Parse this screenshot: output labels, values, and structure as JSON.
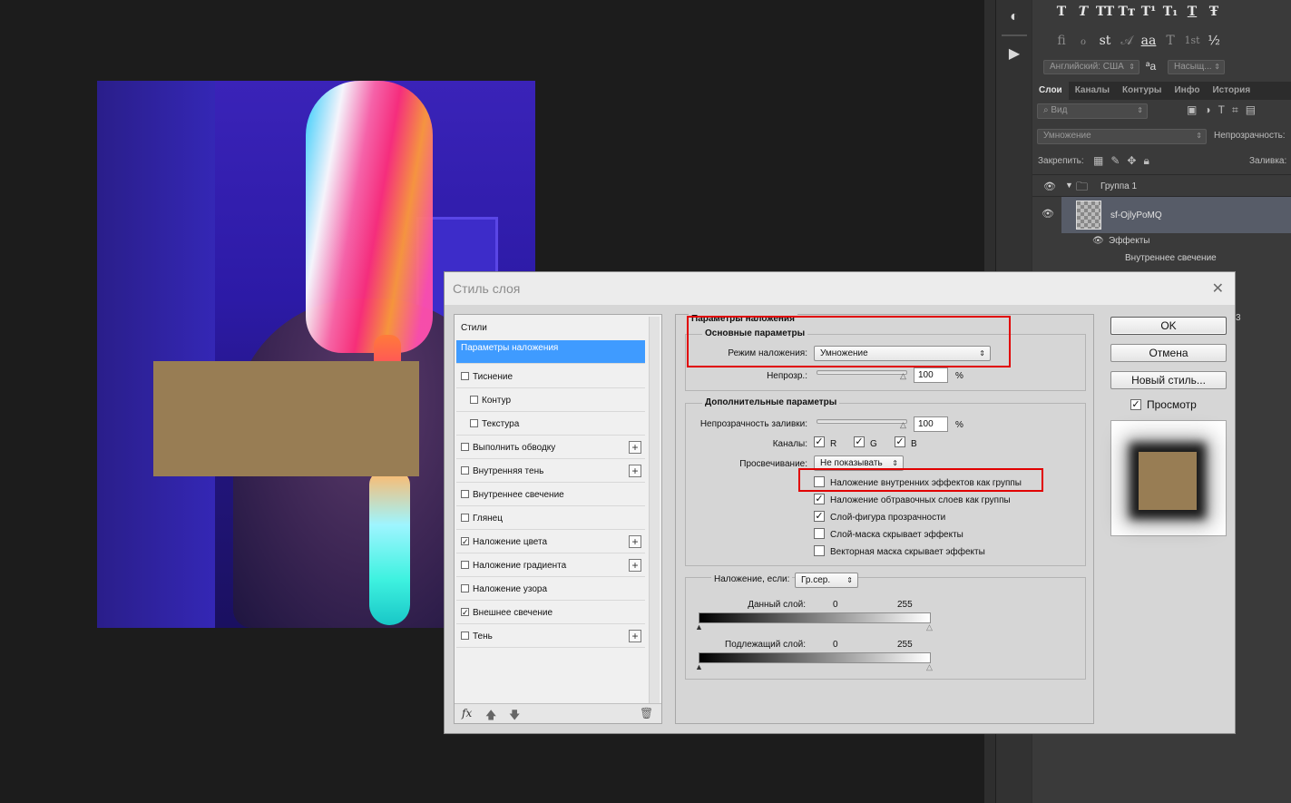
{
  "char_panel": {
    "glyphs_row1": [
      "T",
      "T",
      "TT",
      "Tт",
      "T¹",
      "T₁",
      "T",
      "Ŧ"
    ],
    "glyphs_row2": [
      "fi",
      "ℴ",
      "st",
      "𝒜",
      "aa",
      "T",
      "1st",
      "½"
    ],
    "language": "Английский: США",
    "aa_glyph": "ªa",
    "aa_method": "Насыщ..."
  },
  "layers_panel": {
    "tabs": [
      "Слои",
      "Каналы",
      "Контуры",
      "Инфо",
      "История"
    ],
    "filter_label": "Вид",
    "blend_mode": "Умножение",
    "opacity_label": "Непрозрачность:",
    "lock_label": "Закрепить:",
    "fill_label": "Заливка:",
    "group_name": "Группа 1",
    "layer_name": "sf-OjlyPoMQ",
    "effects_label": "Эффекты",
    "effect_item": "Внутреннее свечение",
    "partial_text": "3"
  },
  "dialog": {
    "title": "Стиль слоя",
    "styles_header": "Стили",
    "style_items": [
      {
        "label": "Параметры наложения",
        "checkbox": false,
        "checked": false,
        "plus": false,
        "selected": true,
        "indent": false
      },
      {
        "label": "Тиснение",
        "checkbox": true,
        "checked": false,
        "plus": false,
        "selected": false,
        "indent": false
      },
      {
        "label": "Контур",
        "checkbox": true,
        "checked": false,
        "plus": false,
        "selected": false,
        "indent": true
      },
      {
        "label": "Текстура",
        "checkbox": true,
        "checked": false,
        "plus": false,
        "selected": false,
        "indent": true
      },
      {
        "label": "Выполнить обводку",
        "checkbox": true,
        "checked": false,
        "plus": true,
        "selected": false,
        "indent": false
      },
      {
        "label": "Внутренняя тень",
        "checkbox": true,
        "checked": false,
        "plus": true,
        "selected": false,
        "indent": false
      },
      {
        "label": "Внутреннее свечение",
        "checkbox": true,
        "checked": false,
        "plus": false,
        "selected": false,
        "indent": false
      },
      {
        "label": "Глянец",
        "checkbox": true,
        "checked": false,
        "plus": false,
        "selected": false,
        "indent": false
      },
      {
        "label": "Наложение цвета",
        "checkbox": true,
        "checked": true,
        "plus": true,
        "selected": false,
        "indent": false
      },
      {
        "label": "Наложение градиента",
        "checkbox": true,
        "checked": false,
        "plus": true,
        "selected": false,
        "indent": false
      },
      {
        "label": "Наложение узора",
        "checkbox": true,
        "checked": false,
        "plus": false,
        "selected": false,
        "indent": false
      },
      {
        "label": "Внешнее свечение",
        "checkbox": true,
        "checked": true,
        "plus": false,
        "selected": false,
        "indent": false
      },
      {
        "label": "Тень",
        "checkbox": true,
        "checked": false,
        "plus": true,
        "selected": false,
        "indent": false
      }
    ],
    "footer_fx": "fx",
    "blending": {
      "section_title": "Параметры наложения",
      "basic_title": "Основные параметры",
      "blend_mode_label": "Режим наложения:",
      "blend_mode_value": "Умножение",
      "opacity_label": "Непрозр.:",
      "opacity_value": "100",
      "percent": "%",
      "advanced_title": "Дополнительные параметры",
      "fill_opacity_label": "Непрозрачность заливки:",
      "fill_opacity_value": "100",
      "channels_label": "Каналы:",
      "channels": [
        {
          "label": "R",
          "checked": true
        },
        {
          "label": "G",
          "checked": true
        },
        {
          "label": "B",
          "checked": true
        }
      ],
      "knockout_label": "Просвечивание:",
      "knockout_value": "Не показывать",
      "options": [
        {
          "label": "Наложение внутренних эффектов как группы",
          "checked": false
        },
        {
          "label": "Наложение обтравочных слоев как группы",
          "checked": true
        },
        {
          "label": "Слой-фигура прозрачности",
          "checked": true
        },
        {
          "label": "Слой-маска скрывает эффекты",
          "checked": false
        },
        {
          "label": "Векторная маска скрывает эффекты",
          "checked": false
        }
      ],
      "blend_if_label": "Наложение, если:",
      "blend_if_value": "Гр.сер.",
      "this_layer_label": "Данный слой:",
      "this_layer_min": "0",
      "this_layer_max": "255",
      "underlying_label": "Подлежащий слой:",
      "underlying_min": "0",
      "underlying_max": "255"
    },
    "buttons": {
      "ok": "OK",
      "cancel": "Отмена",
      "new_style": "Новый стиль..."
    },
    "preview_label": "Просмотр",
    "preview_checked": true
  },
  "colors": {
    "selection_blue": "#3f9bff",
    "highlight_red": "#e10000",
    "redaction_tan": "#987d54"
  }
}
